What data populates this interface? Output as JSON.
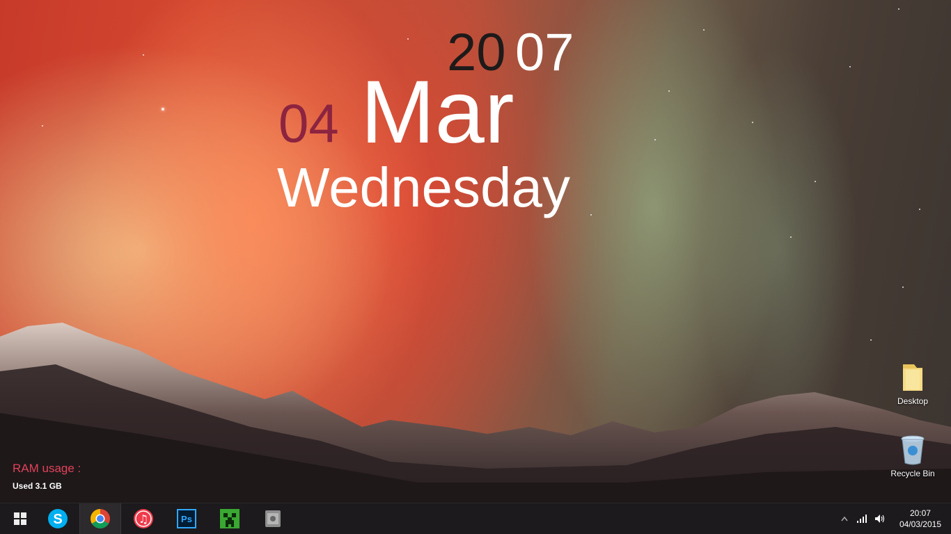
{
  "date_widget": {
    "year_prefix": "20",
    "year_suffix": "07",
    "day_number": "04",
    "month": "Mar",
    "weekday": "Wednesday"
  },
  "ram_widget": {
    "title": "RAM usage :",
    "used": "Used 3.1 GB"
  },
  "desktop_icons": [
    {
      "label": "Desktop",
      "icon": "folder-icon"
    },
    {
      "label": "Recycle Bin",
      "icon": "recycle-bin-icon"
    }
  ],
  "taskbar": {
    "apps": [
      {
        "name": "start",
        "icon": "windows-start-icon"
      },
      {
        "name": "skype",
        "icon": "skype-icon"
      },
      {
        "name": "chrome",
        "icon": "chrome-icon",
        "active": true
      },
      {
        "name": "itunes",
        "icon": "itunes-icon"
      },
      {
        "name": "photoshop",
        "icon": "photoshop-icon",
        "label": "Ps"
      },
      {
        "name": "minecraft",
        "icon": "minecraft-icon"
      },
      {
        "name": "photo-app",
        "icon": "camera-app-icon"
      }
    ],
    "tray": {
      "clock_time": "20:07",
      "clock_date": "04/03/2015"
    }
  },
  "colors": {
    "taskbar": "#1c1a1c",
    "day_number": "#8c2440",
    "ram_title": "#e2425a",
    "skype": "#00aff0",
    "photoshop": "#001d34",
    "minecraft": "#3aa832"
  }
}
